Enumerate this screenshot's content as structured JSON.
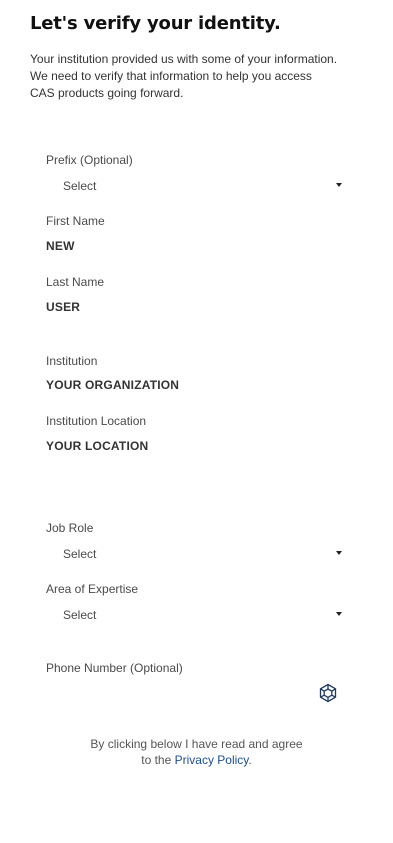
{
  "header": {
    "title": "Let's verify your identity.",
    "intro_lines": [
      "Your institution provided us with some of your information.",
      "We need to verify that information to help you access",
      "CAS products going forward."
    ]
  },
  "form": {
    "prefix": {
      "label": "Prefix (Optional)",
      "value": "Select"
    },
    "first_name": {
      "label": "First Name",
      "value": "NEW"
    },
    "last_name": {
      "label": "Last Name",
      "value": "USER"
    },
    "institution": {
      "label": "Institution",
      "value": "YOUR ORGANIZATION"
    },
    "institution_location": {
      "label": "Institution Location",
      "value": "YOUR LOCATION"
    },
    "job_role": {
      "label": "Job Role",
      "value": "Select"
    },
    "area_of_expertise": {
      "label": "Area of Expertise",
      "value": "Select"
    },
    "phone_number": {
      "label": "Phone Number (Optional)",
      "icon": "cube-icon"
    }
  },
  "footer": {
    "agree_line1": "By clicking below I have read and agree",
    "agree_line2_prefix": "to the ",
    "privacy_link": "Privacy Policy",
    "agree_line2_suffix": "."
  },
  "colors": {
    "link": "#1f4e8c",
    "title": "#111111",
    "text": "#333333"
  }
}
